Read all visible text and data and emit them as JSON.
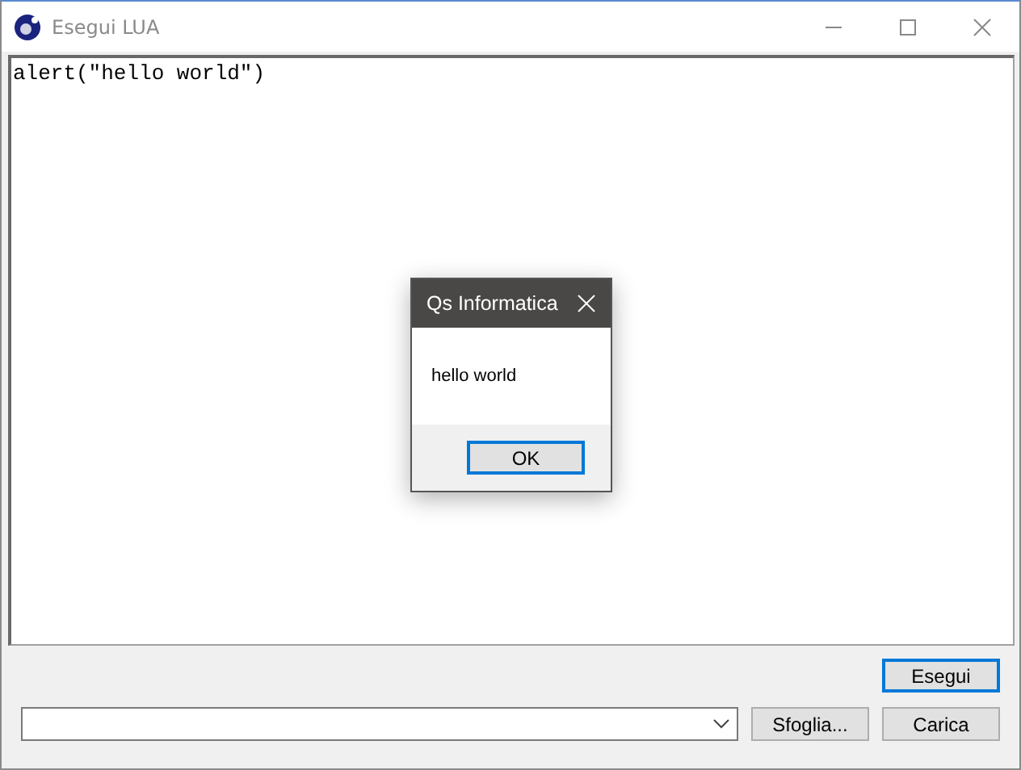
{
  "window": {
    "title": "Esegui LUA"
  },
  "editor": {
    "value": "alert(\"hello world\")"
  },
  "dialog": {
    "title": "Qs Informatica",
    "message": "hello world",
    "buttons": [
      {
        "label": "OK",
        "selected": true
      }
    ]
  },
  "buttons": [
    {
      "label": "Esegui",
      "selected": true
    }
  ],
  "file_bar": {
    "buttons": [
      {
        "label": "Sfoglia...",
        "selected": false
      },
      {
        "label": "Carica",
        "selected": false
      }
    ]
  }
}
